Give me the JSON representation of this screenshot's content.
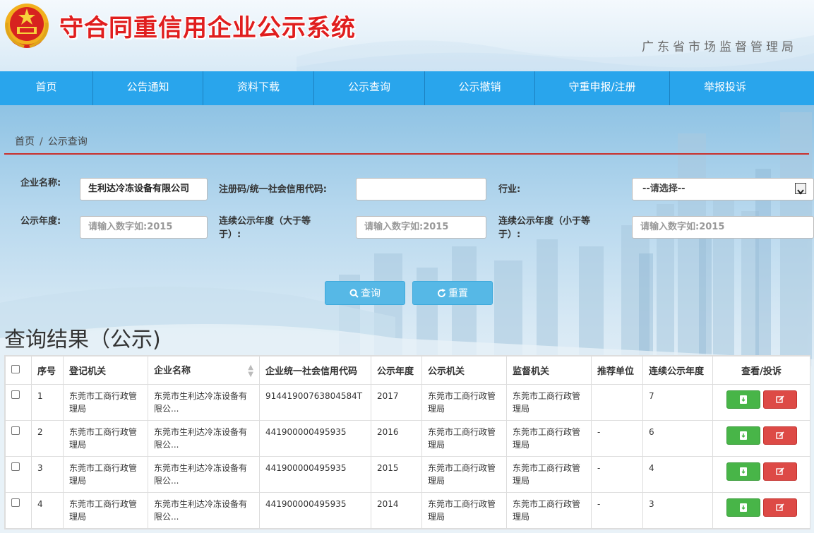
{
  "header": {
    "title": "守合同重信用企业公示系统",
    "bureau": "广东省市场监督管理局"
  },
  "nav": [
    {
      "label": "首页"
    },
    {
      "label": "公告通知"
    },
    {
      "label": "资料下载"
    },
    {
      "label": "公示查询"
    },
    {
      "label": "公示撤销"
    },
    {
      "label": "守重申报/注册"
    },
    {
      "label": "举报投诉"
    }
  ],
  "breadcrumb": {
    "home": "首页",
    "sep": "/",
    "current": "公示查询"
  },
  "form": {
    "company_name_label": "企业名称:",
    "company_name_value": "生利达冷冻设备有限公司",
    "reg_code_label": "注册码/统一社会信用代码:",
    "reg_code_value": "",
    "industry_label": "行业:",
    "industry_value": "--请选择--",
    "year_label": "公示年度:",
    "year_placeholder": "请输入数字如:2015",
    "cont_gt_label": "连续公示年度（大于等于）:",
    "cont_gt_placeholder": "请输入数字如:2015",
    "cont_lt_label": "连续公示年度（小于等于）:",
    "cont_lt_placeholder": "请输入数字如:2015",
    "search_label": "查询",
    "reset_label": "重置"
  },
  "results": {
    "title": "查询结果（公示)",
    "columns": [
      "序号",
      "登记机关",
      "企业名称",
      "企业统一社会信用代码",
      "公示年度",
      "公示机关",
      "监督机关",
      "推荐单位",
      "连续公示年度",
      "查看/投诉"
    ],
    "rows": [
      {
        "no": "1",
        "reg_org": "东莞市工商行政管理局",
        "company": "东莞市生利达冷冻设备有限公...",
        "code": "91441900763804584T",
        "year": "2017",
        "pub_org": "东莞市工商行政管理局",
        "sup_org": "东莞市工商行政管理局",
        "recommend": "",
        "cont_years": "7"
      },
      {
        "no": "2",
        "reg_org": "东莞市工商行政管理局",
        "company": "东莞市生利达冷冻设备有限公...",
        "code": "441900000495935",
        "year": "2016",
        "pub_org": "东莞市工商行政管理局",
        "sup_org": "东莞市工商行政管理局",
        "recommend": "-",
        "cont_years": "6"
      },
      {
        "no": "3",
        "reg_org": "东莞市工商行政管理局",
        "company": "东莞市生利达冷冻设备有限公...",
        "code": "441900000495935",
        "year": "2015",
        "pub_org": "东莞市工商行政管理局",
        "sup_org": "东莞市工商行政管理局",
        "recommend": "-",
        "cont_years": "4"
      },
      {
        "no": "4",
        "reg_org": "东莞市工商行政管理局",
        "company": "东莞市生利达冷冻设备有限公...",
        "code": "441900000495935",
        "year": "2014",
        "pub_org": "东莞市工商行政管理局",
        "sup_org": "东莞市工商行政管理局",
        "recommend": "-",
        "cont_years": "3"
      }
    ]
  },
  "colors": {
    "nav": "#29a5ec",
    "title_red": "#e01e1e",
    "btn_blue": "#56b8e6",
    "btn_green": "#48b548",
    "btn_red": "#dd4a46",
    "divider": "#c9302c"
  }
}
